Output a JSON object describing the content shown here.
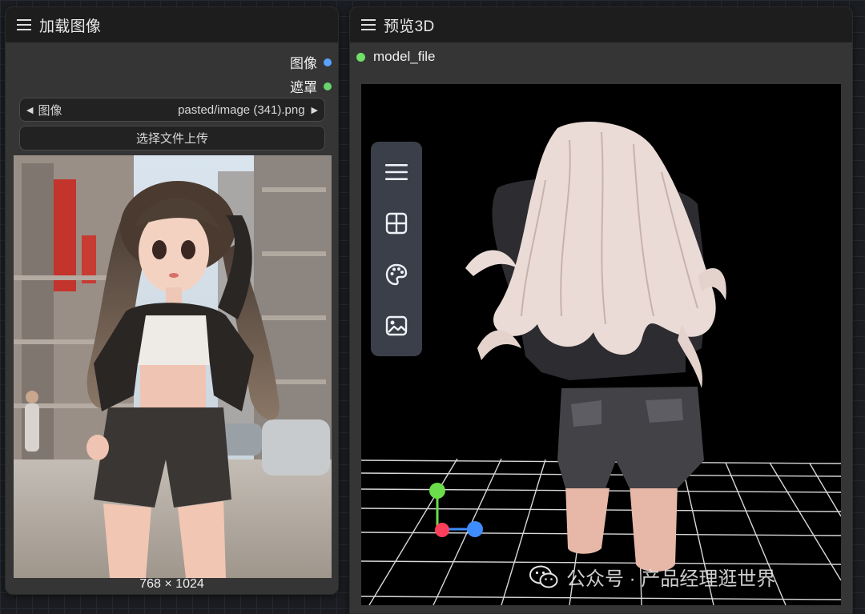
{
  "load_node": {
    "title": "加载图像",
    "outputs": [
      {
        "label": "图像",
        "color": "#5aa2ff"
      },
      {
        "label": "遮罩",
        "color": "#67d46c"
      }
    ],
    "image_widget": {
      "label": "图像",
      "value": "pasted/image (341).png"
    },
    "upload_button": "选择文件上传",
    "image_size": "768 × 1024"
  },
  "preview_node": {
    "title": "预览3D",
    "input": {
      "label": "model_file",
      "color": "#6fe06a"
    },
    "toolbar": [
      "menu-icon",
      "layout-grid-icon",
      "palette-icon",
      "image-icon"
    ],
    "gizmo_colors": {
      "x": "#3f8cff",
      "y": "#6bdd4a",
      "z": "#ff3f5a"
    }
  },
  "watermark": {
    "text": "公众号 · 产品经理逛世界",
    "icon": "wechat-icon"
  }
}
